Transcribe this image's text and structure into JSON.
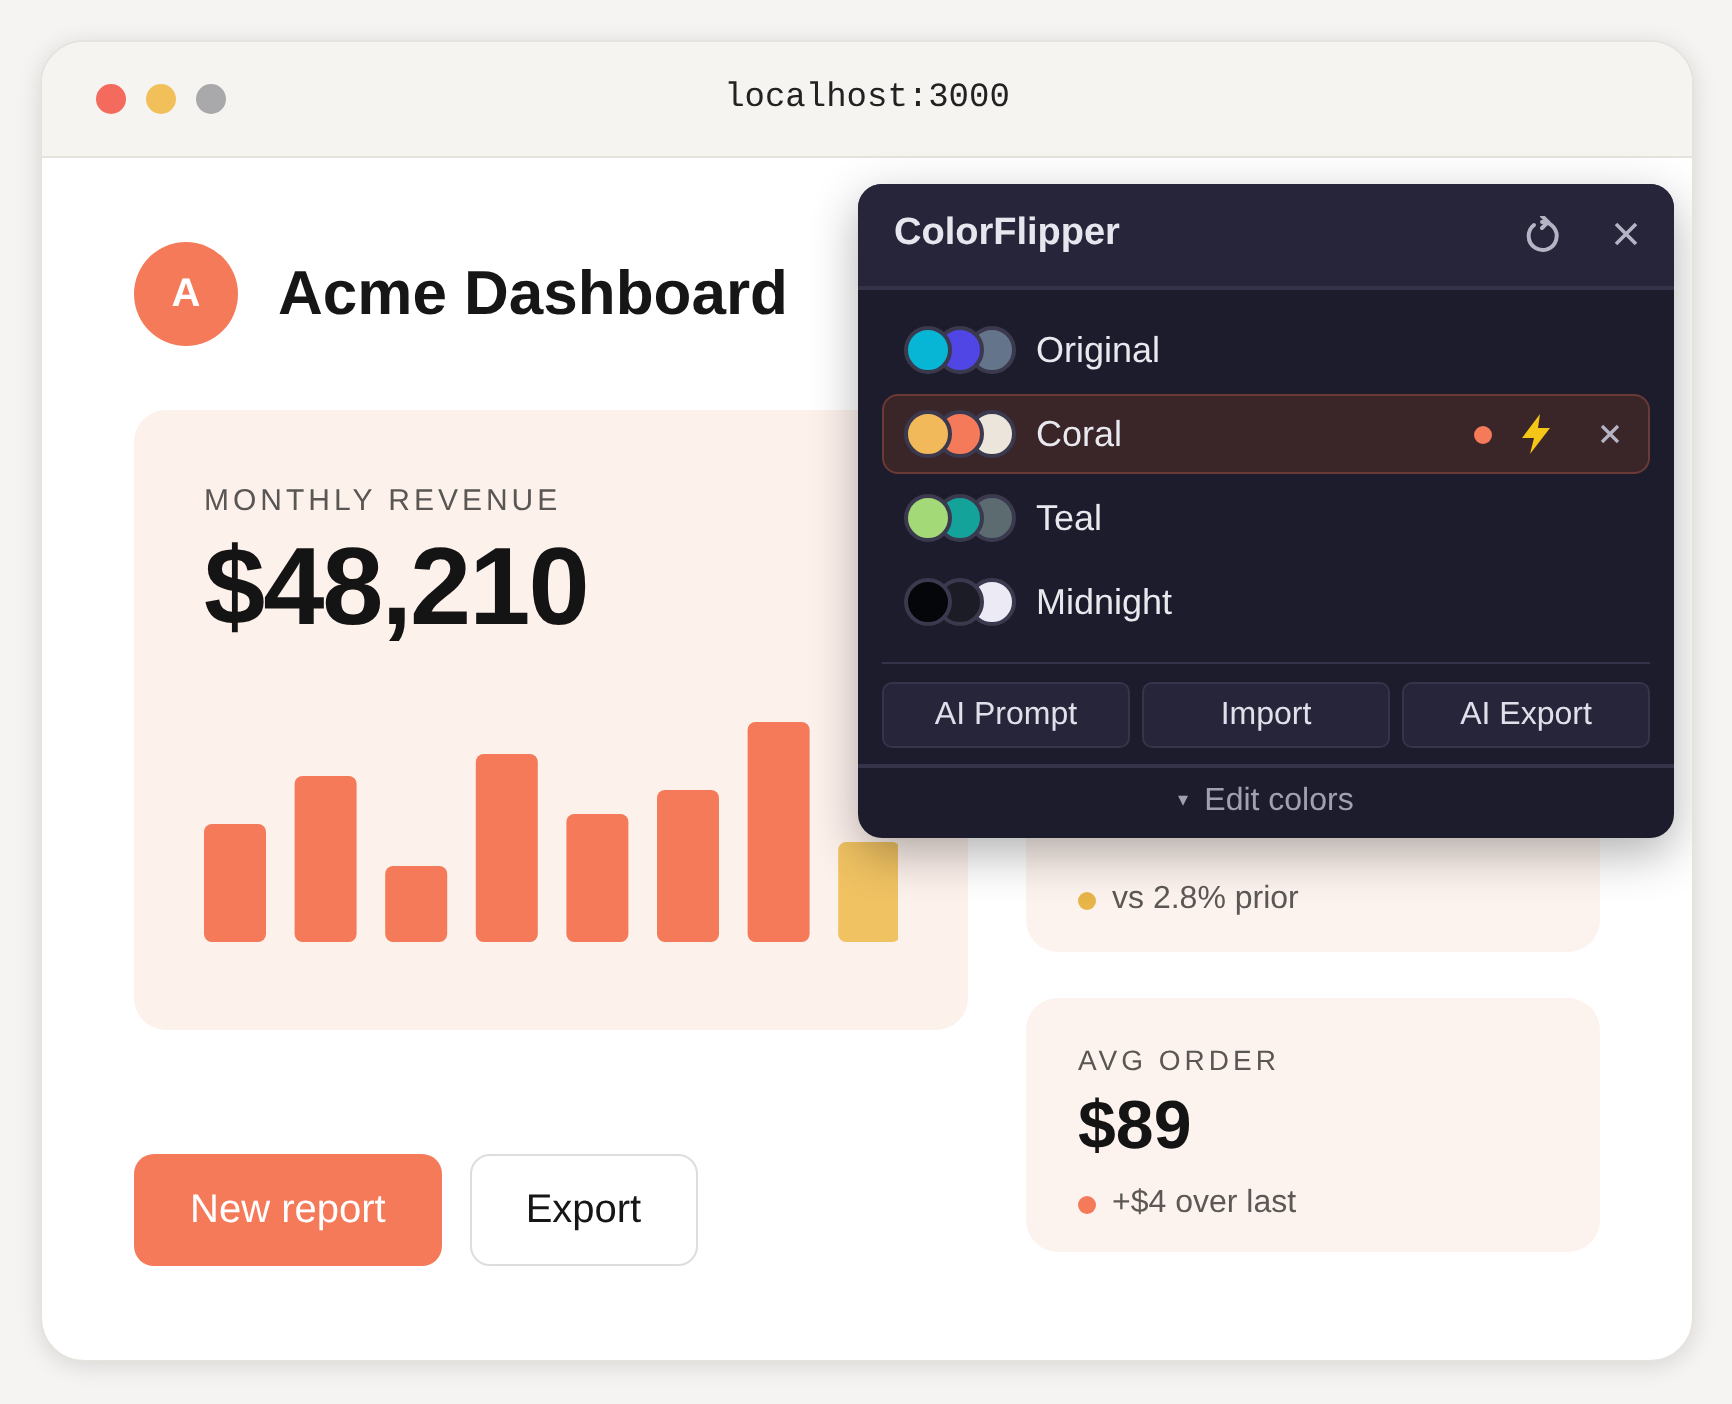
{
  "window": {
    "title": "localhost:3000"
  },
  "header": {
    "avatar": "A",
    "title": "Acme Dashboard"
  },
  "revenue": {
    "label": "MONTHLY REVENUE",
    "value": "$48,210"
  },
  "stats": [
    {
      "note": "vs 2.8% prior",
      "color": "#e8b54a"
    },
    {
      "label": "AVG ORDER",
      "value": "$89",
      "note": "+$4 over last",
      "color": "#f47a5a"
    }
  ],
  "buttons": [
    {
      "label": "New report",
      "kind": "primary"
    },
    {
      "label": "Export",
      "kind": "outline"
    }
  ],
  "popup": {
    "title": "ColorFlipper",
    "palettes": [
      {
        "name": "Original",
        "selected": false,
        "swatches": [
          {
            "color": "#06b6d4"
          },
          {
            "color": "#4f46e5"
          },
          {
            "color": "#64748b"
          }
        ]
      },
      {
        "name": "Coral",
        "selected": true,
        "swatches": [
          {
            "color": "#f2b95a"
          },
          {
            "color": "#f47a5a"
          },
          {
            "color": "#ebe5dc"
          }
        ],
        "dot": {
          "color": "#f47a5a"
        }
      },
      {
        "name": "Teal",
        "selected": false,
        "swatches": [
          {
            "color": "#a3d977"
          },
          {
            "color": "#14a39a"
          },
          {
            "color": "#5b6b70"
          }
        ]
      },
      {
        "name": "Midnight",
        "selected": false,
        "swatches": [
          {
            "color": "#05060a"
          },
          {
            "color": "#1c1c26"
          },
          {
            "color": "#ebeaf5"
          }
        ]
      }
    ],
    "actions": [
      "AI Prompt",
      "Import",
      "AI Export"
    ],
    "footer": {
      "caret": "▾",
      "label": "Edit colors"
    }
  }
}
